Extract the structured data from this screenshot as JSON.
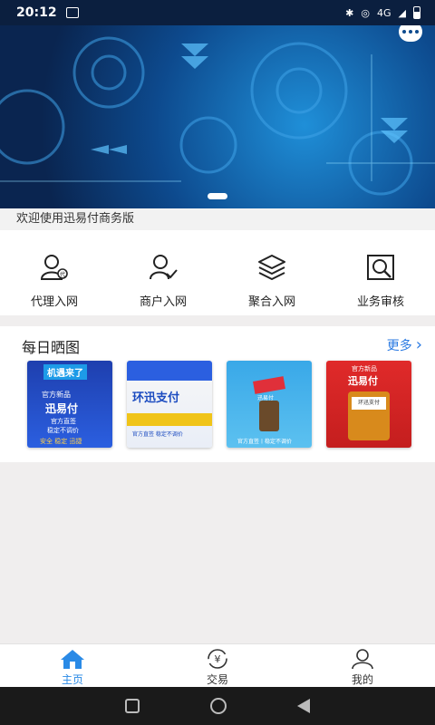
{
  "status_bar": {
    "time": "20:12",
    "network": "4G"
  },
  "banner": {
    "carousel_index": 1
  },
  "welcome_text": "欢迎使用迅易付商务版",
  "menu": {
    "items": [
      {
        "label": "代理入网",
        "icon": "agent-person-icon"
      },
      {
        "label": "商户入网",
        "icon": "merchant-check-icon"
      },
      {
        "label": "聚合入网",
        "icon": "layers-icon"
      },
      {
        "label": "业务审核",
        "icon": "review-search-icon"
      }
    ]
  },
  "daily": {
    "title": "每日晒图",
    "more": "更多",
    "thumbs": [
      {
        "line1": "机遇来了",
        "line2": "官方新品",
        "line3": "迅易付",
        "line4": "官方直签",
        "line5": "稳定不调价",
        "line6": "安全  稳定  迅捷"
      },
      {
        "line1": "环迅支付",
        "line2": "官方直签  稳定不调价"
      },
      {
        "line1": "迅易付",
        "line2": "官方直签丨稳定不调价"
      },
      {
        "line1": "官方新品",
        "line2": "迅易付",
        "line3": "环迅支付"
      }
    ]
  },
  "bottom_nav": {
    "items": [
      {
        "label": "主页",
        "active": true
      },
      {
        "label": "交易",
        "active": false
      },
      {
        "label": "我的",
        "active": false
      }
    ]
  },
  "colors": {
    "accent": "#2a8ae6",
    "banner": "#0d4a8e"
  }
}
